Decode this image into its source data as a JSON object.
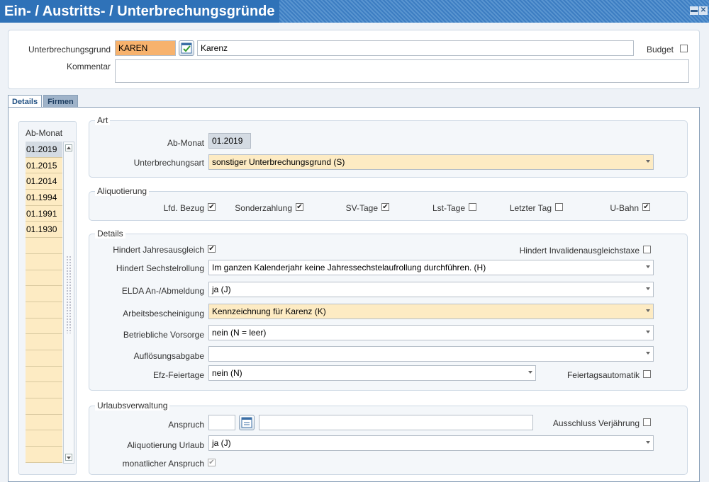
{
  "window": {
    "title": "Ein- / Austritts- / Unterbrechungsgründe"
  },
  "header": {
    "grund_label": "Unterbrechungsgrund",
    "grund_code": "KAREN",
    "grund_desc": "Karenz",
    "budget_label": "Budget",
    "kommentar_label": "Kommentar",
    "kommentar_value": ""
  },
  "tabs": [
    {
      "label": "Details"
    },
    {
      "label": "Firmen"
    }
  ],
  "list": {
    "header": "Ab-Monat",
    "items": [
      "01.2019",
      "01.2015",
      "01.2014",
      "01.1994",
      "01.1991",
      "01.1930"
    ]
  },
  "art": {
    "legend": "Art",
    "abmonat_label": "Ab-Monat",
    "abmonat_value": "01.2019",
    "art_label": "Unterbrechungsart",
    "art_value": "sonstiger Unterbrechungsgrund (S)"
  },
  "aliquotierung": {
    "legend": "Aliquotierung",
    "items": [
      {
        "label": "Lfd. Bezug",
        "checked": true
      },
      {
        "label": "Sonderzahlung",
        "checked": true
      },
      {
        "label": "SV-Tage",
        "checked": true
      },
      {
        "label": "Lst-Tage",
        "checked": false
      },
      {
        "label": "Letzter Tag",
        "checked": false
      },
      {
        "label": "U-Bahn",
        "checked": true
      }
    ]
  },
  "details": {
    "legend": "Details",
    "jahresausgleich_label": "Hindert Jahresausgleich",
    "invalid_label": "Hindert Invalidenausgleichstaxe",
    "sechstel_label": "Hindert Sechstelrollung",
    "sechstel_value": "Im ganzen Kalenderjahr keine Jahressechstelaufrollung durchführen. (H)",
    "elda_label": "ELDA An-/Abmeldung",
    "elda_value": "ja (J)",
    "arbeit_label": "Arbeitsbescheinigung",
    "arbeit_value": "Kennzeichnung für Karenz (K)",
    "vorsorge_label": "Betriebliche Vorsorge",
    "vorsorge_value": "nein (N = leer)",
    "aufloesung_label": "Auflösungsabgabe",
    "aufloesung_value": "",
    "efz_label": "Efz-Feiertage",
    "efz_value": "nein (N)",
    "feiertag_label": "Feiertagsautomatik"
  },
  "urlaub": {
    "legend": "Urlaubsverwaltung",
    "anspruch_label": "Anspruch",
    "anspruch_value": "",
    "anspruch_desc": "",
    "verjaehrung_label": "Ausschluss Verjährung",
    "aliq_label": "Aliquotierung Urlaub",
    "aliq_value": "ja (J)",
    "monatlich_label": "monatlicher Anspruch"
  },
  "colors": {
    "title_bar": "#2f72b8",
    "highlight_orange": "#f7b26d",
    "highlight_yellow": "#fdebc3"
  }
}
